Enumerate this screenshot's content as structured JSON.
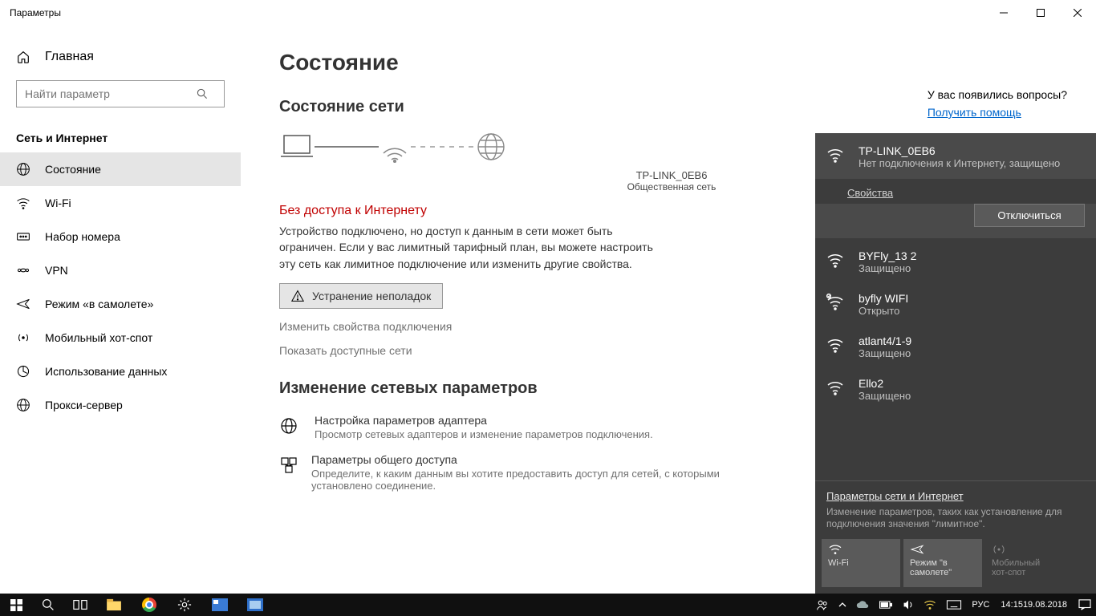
{
  "titlebar": {
    "title": "Параметры"
  },
  "sidebar": {
    "home": "Главная",
    "search_placeholder": "Найти параметр",
    "section": "Сеть и Интернет",
    "items": [
      {
        "label": "Состояние"
      },
      {
        "label": "Wi-Fi"
      },
      {
        "label": "Набор номера"
      },
      {
        "label": "VPN"
      },
      {
        "label": "Режим «в самолете»"
      },
      {
        "label": "Мобильный хот-спот"
      },
      {
        "label": "Использование данных"
      },
      {
        "label": "Прокси-сервер"
      }
    ]
  },
  "main": {
    "heading": "Состояние",
    "sub": "Состояние сети",
    "ssid": "TP-LINK_0EB6",
    "net_type": "Общественная сеть",
    "alert": "Без доступа к Интернету",
    "desc": "Устройство подключено, но доступ к данным в сети может быть ограничен. Если у вас лимитный тарифный план, вы можете настроить эту сеть как лимитное подключение или изменить другие свойства.",
    "troubleshoot": "Устранение неполадок",
    "link_props": "Изменить свойства подключения",
    "link_show": "Показать доступные сети",
    "change_heading": "Изменение сетевых параметров",
    "opt_adapter_title": "Настройка параметров адаптера",
    "opt_adapter_desc": "Просмотр сетевых адаптеров и изменение параметров подключения.",
    "opt_share_title": "Параметры общего доступа",
    "opt_share_desc": "Определите, к каким данным вы хотите предоставить доступ для сетей, с которыми установлено соединение."
  },
  "help": {
    "q": "У вас появились вопросы?",
    "link": "Получить помощь"
  },
  "flyout": {
    "current": {
      "ssid": "TP-LINK_0EB6",
      "status": "Нет подключения к Интернету, защищено",
      "props": "Свойства",
      "disconnect": "Отключиться"
    },
    "networks": [
      {
        "ssid": "BYFly_13 2",
        "status": "Защищено"
      },
      {
        "ssid": "byfly WIFI",
        "status": "Открыто",
        "open": true
      },
      {
        "ssid": "atlant4/1-9",
        "status": "Защищено"
      },
      {
        "ssid": "Ello2",
        "status": "Защищено"
      }
    ],
    "footer_link": "Параметры сети и Интернет",
    "footer_desc": "Изменение параметров, таких как установление для подключения значения \"лимитное\".",
    "tile_wifi": "Wi-Fi",
    "tile_air": "Режим \"в самолете\"",
    "tile_hot": "Мобильный хот-спот"
  },
  "taskbar": {
    "lang": "РУС",
    "time": "14:15",
    "date": "19.08.2018"
  }
}
